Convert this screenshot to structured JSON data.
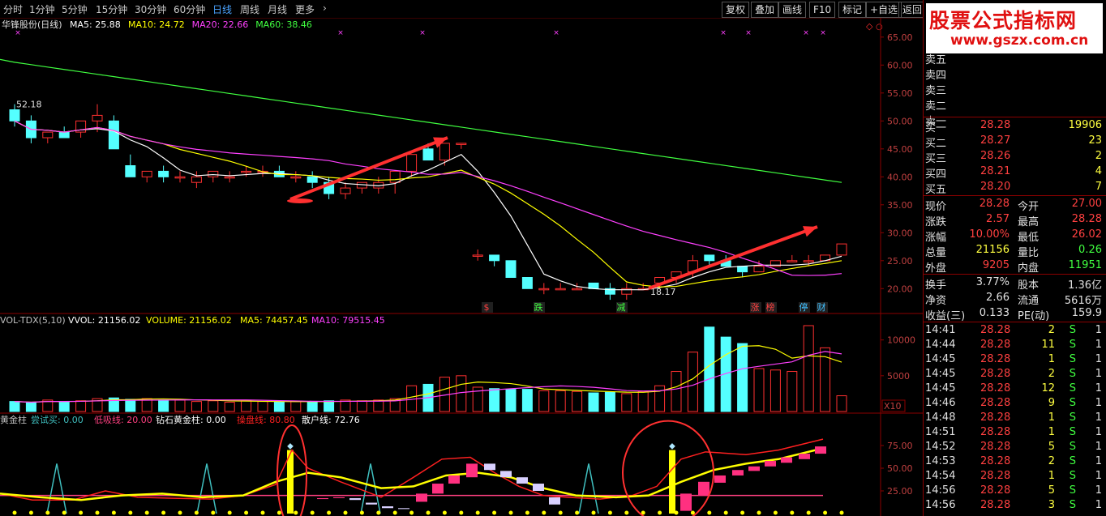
{
  "toolbar": {
    "periods": [
      "分时",
      "1分钟",
      "5分钟",
      "15分钟",
      "30分钟",
      "60分钟",
      "日线",
      "周线",
      "月线",
      "更多"
    ],
    "active": "日线",
    "buttons": [
      "复权",
      "叠加",
      "画线",
      "F10",
      "标记",
      "+自选",
      "返回"
    ]
  },
  "main_chart": {
    "title": "华锋股份(日线)",
    "ma_labels": [
      {
        "text": "MA5: 25.88",
        "color": "#ffffff"
      },
      {
        "text": "MA10: 24.72",
        "color": "#ffff00"
      },
      {
        "text": "MA20: 22.66",
        "color": "#ff40ff"
      },
      {
        "text": "MA60: 38.46",
        "color": "#40ff40"
      }
    ],
    "y_ticks": [
      "65.00",
      "60.00",
      "55.00",
      "50.00",
      "45.00",
      "40.00",
      "35.00",
      "30.00",
      "25.00",
      "20.00"
    ],
    "high_label": "52.18",
    "low_label": "18.17",
    "markers": [
      {
        "text": "$",
        "color": "#ff4040"
      },
      {
        "text": "跌",
        "color": "#40ff40"
      },
      {
        "text": "减",
        "color": "#40ff40"
      },
      {
        "text": "涨",
        "color": "#ff4040"
      },
      {
        "text": "榜",
        "color": "#ff4040"
      },
      {
        "text": "停",
        "color": "#40c0ff"
      },
      {
        "text": "财",
        "color": "#40c0ff"
      }
    ]
  },
  "vol_chart": {
    "labels": [
      {
        "text": "VOL-TDX(5,10)",
        "color": "#c0c0c0"
      },
      {
        "text": "VVOL: 21156.02",
        "color": "#ffffff"
      },
      {
        "text": "VOLUME: 21156.02",
        "color": "#ffff00"
      },
      {
        "text": "MA5: 74457.45",
        "color": "#ffff00"
      },
      {
        "text": "MA10: 79515.45",
        "color": "#ff40ff"
      }
    ],
    "y_ticks": [
      "10000",
      "5000"
    ],
    "unit": "X10"
  },
  "gold_chart": {
    "labels": [
      {
        "text": "黄金柱",
        "color": "#c0c0c0"
      },
      {
        "text": "尝试买: 0.00",
        "color": "#40c0c0"
      },
      {
        "text": "低吸线: 20.00",
        "color": "#ff4080"
      },
      {
        "text": "钻石黄金柱: 0.00",
        "color": "#ffffff"
      },
      {
        "text": "操盘线: 80.80",
        "color": "#ff2020"
      },
      {
        "text": "散户线: 72.76",
        "color": "#ffffff"
      }
    ],
    "y_ticks": [
      "75.00",
      "50.00",
      "25.00"
    ]
  },
  "chart_data": {
    "type": "candlestick",
    "price_ylim": [
      17,
      67
    ],
    "candles": [
      [
        52,
        53,
        49,
        50
      ],
      [
        50,
        51,
        46,
        47
      ],
      [
        47,
        48,
        46,
        48
      ],
      [
        48,
        49,
        47,
        47
      ],
      [
        48,
        50,
        47,
        50
      ],
      [
        50,
        53,
        48,
        51
      ],
      [
        50,
        51,
        45,
        45
      ],
      [
        42,
        44,
        40,
        40
      ],
      [
        40,
        41,
        39,
        41
      ],
      [
        41,
        42,
        39,
        40
      ],
      [
        40,
        41,
        39,
        40
      ],
      [
        39,
        41,
        38,
        40
      ],
      [
        40,
        41,
        39,
        41
      ],
      [
        40,
        41,
        39,
        40
      ],
      [
        41,
        42,
        40,
        41
      ],
      [
        41,
        42,
        40,
        41
      ],
      [
        41,
        42,
        40,
        40
      ],
      [
        40,
        41,
        39,
        40
      ],
      [
        40,
        41,
        38,
        39
      ],
      [
        39,
        40,
        36,
        37
      ],
      [
        37,
        39,
        36,
        38
      ],
      [
        38,
        39,
        37,
        39
      ],
      [
        38,
        40,
        37,
        39
      ],
      [
        39,
        41,
        37,
        41
      ],
      [
        41,
        44,
        40,
        44
      ],
      [
        45,
        46,
        43,
        43
      ],
      [
        43,
        46,
        42,
        46
      ],
      [
        46,
        46,
        45,
        46
      ],
      [
        26,
        27,
        25,
        26
      ],
      [
        26,
        26,
        24,
        25
      ],
      [
        25,
        25,
        22,
        22
      ],
      [
        22,
        22,
        20,
        20
      ],
      [
        20,
        21,
        19,
        20
      ],
      [
        20,
        21,
        20,
        20
      ],
      [
        20,
        21,
        20,
        20
      ],
      [
        21,
        21,
        20,
        20
      ],
      [
        20,
        21,
        18,
        19
      ],
      [
        19,
        21,
        18,
        20
      ],
      [
        20,
        21,
        20,
        20
      ],
      [
        21,
        22,
        20,
        22
      ],
      [
        22,
        23,
        21,
        23
      ],
      [
        23,
        26,
        22,
        25
      ],
      [
        26,
        26,
        24,
        25
      ],
      [
        25,
        26,
        24,
        24
      ],
      [
        24,
        24,
        22,
        23
      ],
      [
        23,
        25,
        23,
        24
      ],
      [
        24,
        25,
        24,
        25
      ],
      [
        25,
        26,
        25,
        25
      ],
      [
        25,
        26,
        24,
        25
      ],
      [
        25,
        26,
        25,
        26
      ],
      [
        26,
        28,
        26,
        28
      ]
    ],
    "volume_ylim": [
      0,
      12000
    ],
    "volume": [
      1400,
      1200,
      1600,
      1400,
      1500,
      1800,
      1900,
      1700,
      1800,
      1600,
      1600,
      1400,
      1500,
      1300,
      1500,
      1400,
      1300,
      1400,
      1300,
      1500,
      1600,
      1500,
      1600,
      1800,
      3600,
      3800,
      4800,
      5000,
      3400,
      3200,
      3100,
      3100,
      2900,
      2900,
      2800,
      2600,
      2700,
      2500,
      2800,
      3600,
      5600,
      8300,
      11800,
      10400,
      9500,
      6000,
      5800,
      5600,
      12000,
      8900,
      2200
    ],
    "gold_ylim": [
      0,
      100
    ],
    "ma": {
      "MA5": 25.88,
      "MA10": 24.72,
      "MA20": 22.66,
      "MA60": 38.46
    }
  },
  "side": {
    "logo_line1": "股票公式指标网",
    "logo_line2": "www.gszx.com.cn",
    "sell": [
      {
        "label": "卖五",
        "price": "",
        "vol": ""
      },
      {
        "label": "卖四",
        "price": "",
        "vol": ""
      },
      {
        "label": "卖三",
        "price": "",
        "vol": ""
      },
      {
        "label": "卖二",
        "price": "",
        "vol": ""
      },
      {
        "label": "卖一",
        "price": "",
        "vol": ""
      }
    ],
    "buy": [
      {
        "label": "买一",
        "price": "28.28",
        "vol": "19906"
      },
      {
        "label": "买二",
        "price": "28.27",
        "vol": "23"
      },
      {
        "label": "买三",
        "price": "28.26",
        "vol": "2"
      },
      {
        "label": "买四",
        "price": "28.21",
        "vol": "4"
      },
      {
        "label": "买五",
        "price": "28.20",
        "vol": "7"
      }
    ],
    "stats": [
      {
        "l1": "现价",
        "v1": "28.28",
        "c1": "red",
        "l2": "今开",
        "v2": "27.00",
        "c2": "red"
      },
      {
        "l1": "涨跌",
        "v1": "2.57",
        "c1": "red",
        "l2": "最高",
        "v2": "28.28",
        "c2": "red"
      },
      {
        "l1": "涨幅",
        "v1": "10.00%",
        "c1": "red",
        "l2": "最低",
        "v2": "26.02",
        "c2": "red"
      },
      {
        "l1": "总量",
        "v1": "21156",
        "c1": "yel",
        "l2": "量比",
        "v2": "0.26",
        "c2": "grn"
      },
      {
        "l1": "外盘",
        "v1": "9205",
        "c1": "red",
        "l2": "内盘",
        "v2": "11951",
        "c2": "grn"
      }
    ],
    "stats2": [
      {
        "l1": "换手",
        "v1": "3.77%",
        "l2": "股本",
        "v2": "1.36亿"
      },
      {
        "l1": "净资",
        "v1": "2.66",
        "l2": "流通",
        "v2": "5616万"
      },
      {
        "l1": "收益(三)",
        "v1": "0.133",
        "l2": "PE(动)",
        "v2": "159.9"
      }
    ],
    "ticks": [
      {
        "time": "14:41",
        "price": "28.28",
        "vol": "2",
        "bs": "S",
        "n": "1"
      },
      {
        "time": "14:44",
        "price": "28.28",
        "vol": "11",
        "bs": "S",
        "n": "1"
      },
      {
        "time": "14:45",
        "price": "28.28",
        "vol": "1",
        "bs": "S",
        "n": "1"
      },
      {
        "time": "14:45",
        "price": "28.28",
        "vol": "2",
        "bs": "S",
        "n": "1"
      },
      {
        "time": "14:45",
        "price": "28.28",
        "vol": "12",
        "bs": "S",
        "n": "1"
      },
      {
        "time": "14:46",
        "price": "28.28",
        "vol": "9",
        "bs": "S",
        "n": "1"
      },
      {
        "time": "14:48",
        "price": "28.28",
        "vol": "1",
        "bs": "S",
        "n": "1"
      },
      {
        "time": "14:51",
        "price": "28.28",
        "vol": "1",
        "bs": "S",
        "n": "1"
      },
      {
        "time": "14:52",
        "price": "28.28",
        "vol": "5",
        "bs": "S",
        "n": "1"
      },
      {
        "time": "14:53",
        "price": "28.28",
        "vol": "2",
        "bs": "S",
        "n": "1"
      },
      {
        "time": "14:54",
        "price": "28.28",
        "vol": "1",
        "bs": "S",
        "n": "1"
      },
      {
        "time": "14:56",
        "price": "28.28",
        "vol": "5",
        "bs": "S",
        "n": "1"
      },
      {
        "time": "14:56",
        "price": "28.28",
        "vol": "3",
        "bs": "S",
        "n": "1"
      }
    ]
  }
}
